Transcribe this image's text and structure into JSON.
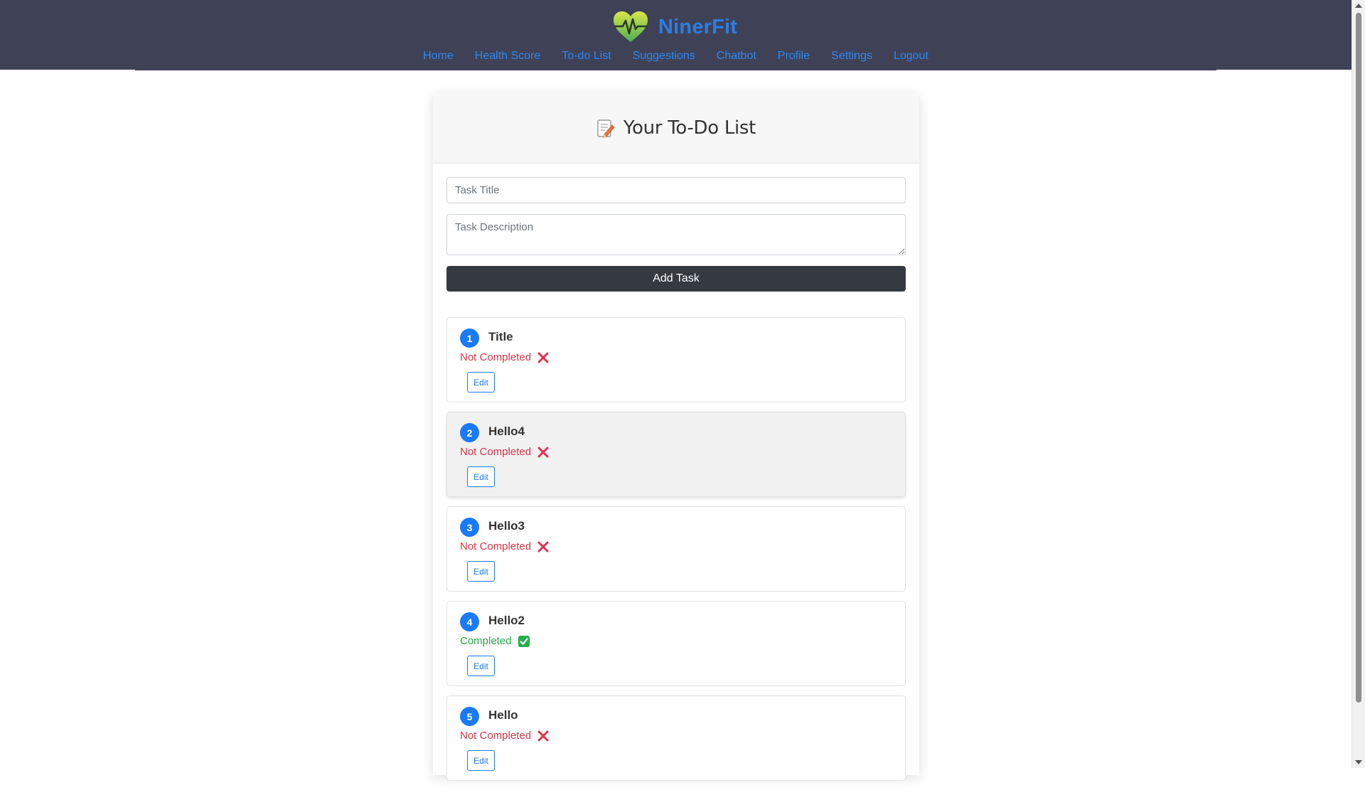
{
  "app": {
    "name": "NinerFit"
  },
  "nav": {
    "links": [
      "Home",
      "Health Score",
      "To-do List",
      "Suggestions",
      "Chatbot",
      "Profile",
      "Settings",
      "Logout"
    ]
  },
  "card": {
    "title": "Your To-Do List",
    "icon": "memo-icon"
  },
  "form": {
    "title_placeholder": "Task Title",
    "description_placeholder": "Task Description",
    "add_label": "Add Task"
  },
  "tasks": [
    {
      "number": "1",
      "title": "Title",
      "status": "Not Completed",
      "completed": false,
      "edit_label": "Edit"
    },
    {
      "number": "2",
      "title": "Hello4",
      "status": "Not Completed",
      "completed": false,
      "edit_label": "Edit"
    },
    {
      "number": "3",
      "title": "Hello3",
      "status": "Not Completed",
      "completed": false,
      "edit_label": "Edit"
    },
    {
      "number": "4",
      "title": "Hello2",
      "status": "Completed",
      "completed": true,
      "edit_label": "Edit"
    },
    {
      "number": "5",
      "title": "Hello",
      "status": "Not Completed",
      "completed": false,
      "edit_label": "Edit"
    }
  ],
  "colors": {
    "navbar": "#3f4257",
    "brand": "#2e7de0",
    "link": "#2f86f0",
    "primary": "#1a7af8",
    "danger": "#dc3545",
    "success": "#28a745",
    "dark_button": "#343a40"
  }
}
